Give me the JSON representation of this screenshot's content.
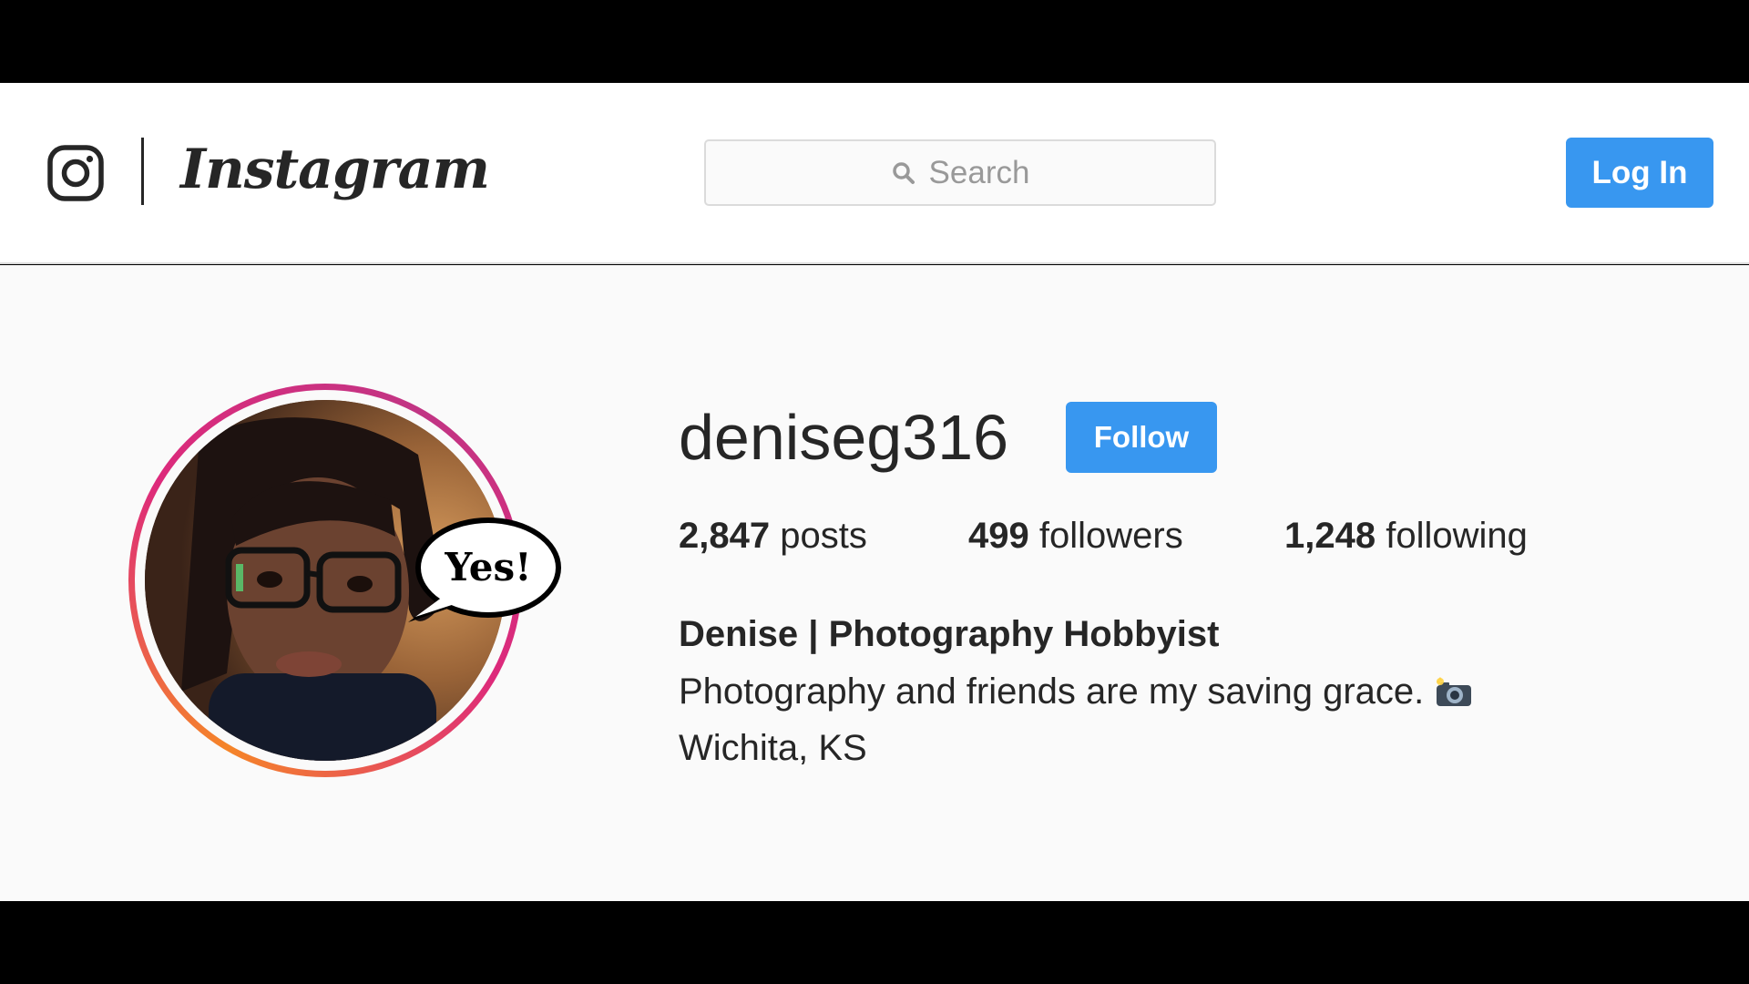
{
  "header": {
    "brand": "Instagram",
    "search_placeholder": "Search",
    "login_label": "Log In",
    "accent_color": "#3897f0"
  },
  "profile": {
    "username": "deniseg316",
    "follow_label": "Follow",
    "avatar_bubble_text": "Yes!",
    "stats": [
      {
        "value": "2,847",
        "label": "posts"
      },
      {
        "value": "499",
        "label": "followers"
      },
      {
        "value": "1,248",
        "label": "following"
      }
    ],
    "full_name": "Denise | Photography Hobbyist",
    "bio": "Photography and friends are my saving grace.",
    "bio_emoji": "camera-with-flash-icon",
    "location": "Wichita, KS"
  }
}
